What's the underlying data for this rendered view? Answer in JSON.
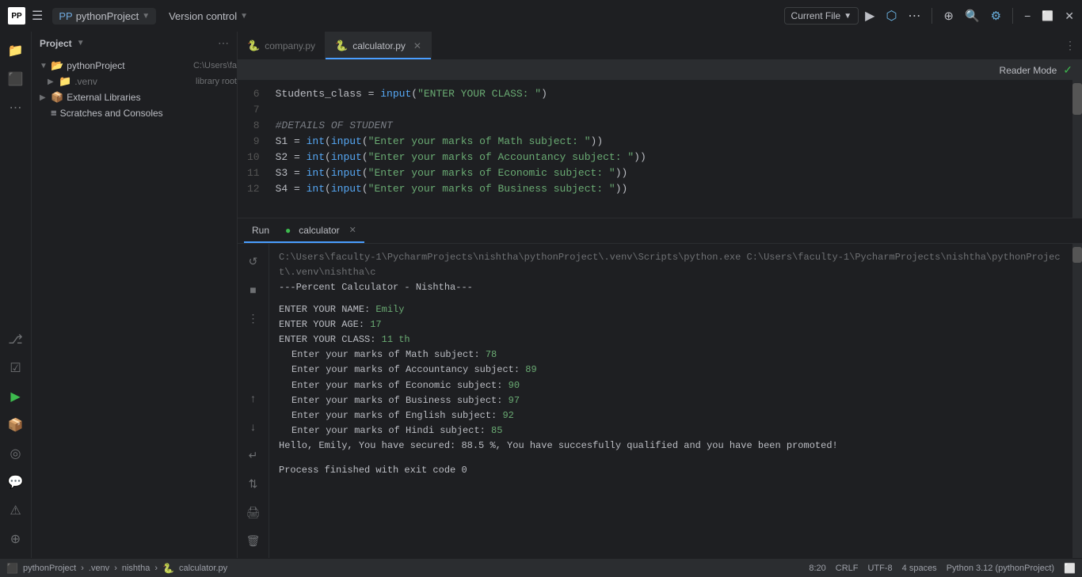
{
  "titlebar": {
    "logo": "PP",
    "project_name": "pythonProject",
    "vcs_label": "Version control",
    "current_file_label": "Current File",
    "run_icon": "▶",
    "debug_icon": "⚙",
    "more_icon": "⋯",
    "add_user_icon": "👤",
    "search_icon": "🔍",
    "settings_icon": "⚙",
    "minimize": "−",
    "maximize": "⬜",
    "close": "✕",
    "window_title": "pythonProject"
  },
  "sidebar": {
    "title": "Project",
    "tree": [
      {
        "level": 0,
        "type": "folder",
        "label": "pythonProject",
        "extra": "C:\\Users\\fa",
        "arrow": "▼",
        "expanded": true
      },
      {
        "level": 1,
        "type": "folder",
        "label": ".venv",
        "extra": "library root",
        "arrow": "▶",
        "expanded": false
      },
      {
        "level": 0,
        "type": "folder",
        "label": "External Libraries",
        "extra": "",
        "arrow": "▶",
        "expanded": false
      },
      {
        "level": 0,
        "type": "item",
        "label": "Scratches and Consoles",
        "extra": "",
        "arrow": "",
        "expanded": false
      }
    ]
  },
  "tabs": [
    {
      "label": "company.py",
      "icon": "py",
      "active": false,
      "closable": false
    },
    {
      "label": "calculator.py",
      "icon": "py",
      "active": true,
      "closable": true
    }
  ],
  "reader_mode": "Reader Mode",
  "code_lines": [
    {
      "num": 6,
      "content": "Students_class = input(\"ENTER YOUR CLASS: \")"
    },
    {
      "num": 7,
      "content": ""
    },
    {
      "num": 8,
      "content": "#DETAILS OF STUDENT"
    },
    {
      "num": 9,
      "content": "S1 = int(input(\"Enter your marks of Math subject: \"))"
    },
    {
      "num": 10,
      "content": "S2 = int(input(\"Enter your marks of Accountancy subject: \"))"
    },
    {
      "num": 11,
      "content": "S3 = int(input(\"Enter your marks of Economic subject: \"))"
    },
    {
      "num": 12,
      "content": "S4 = int(input(\"Enter your marks of Business subject: \"))"
    }
  ],
  "run_panel": {
    "tab_label": "Run",
    "process_tab_label": "calculator",
    "path": "C:\\Users\\faculty-1\\PycharmProjects\\nishtha\\pythonProject\\.venv\\Scripts\\python.exe C:\\Users\\faculty-1\\PycharmProjects\\nishtha\\pythonProject\\.venv\\nishtha\\c",
    "title": "---Percent Calculator - Nishtha---",
    "prompts": [
      {
        "label": "ENTER YOUR NAME:",
        "value": "Emily"
      },
      {
        "label": "ENTER YOUR AGE:",
        "value": "17"
      },
      {
        "label": "ENTER YOUR CLASS:",
        "value": "11 th"
      },
      {
        "label": "Enter your marks of Math subject:",
        "value": "78"
      },
      {
        "label": "Enter your marks of Accountancy subject:",
        "value": "89"
      },
      {
        "label": "Enter your marks of Economic subject:",
        "value": "90"
      },
      {
        "label": "Enter your marks of Business subject:",
        "value": "97"
      },
      {
        "label": "Enter your marks of English subject:",
        "value": "92"
      },
      {
        "label": "Enter your marks of Hindi subject:",
        "value": "85"
      }
    ],
    "result": "Hello, Emily, You have secured: 88.5 %, You have succesfully qualified and you have been promoted!",
    "process_end": "Process finished with exit code 0"
  },
  "statusbar": {
    "project_label": "pythonProject",
    "venv_label": ".venv",
    "nishtha_label": "nishtha",
    "file_label": "calculator.py",
    "position": "8:20",
    "line_ending": "CRLF",
    "encoding": "UTF-8",
    "indent": "4 spaces",
    "python_version": "Python 3.12 (pythonProject)"
  },
  "activity_icons": [
    "📁",
    "⬛",
    "⋯",
    "🔄",
    "📋",
    "▶",
    "📦",
    "🔊",
    "💬",
    "⚠",
    "🔧"
  ],
  "colors": {
    "accent": "#4a9eff",
    "green": "#3dba4e",
    "bg_dark": "#1e1f22",
    "bg_mid": "#2b2d30",
    "text_main": "#bcbec4",
    "text_dim": "#6e7073"
  }
}
